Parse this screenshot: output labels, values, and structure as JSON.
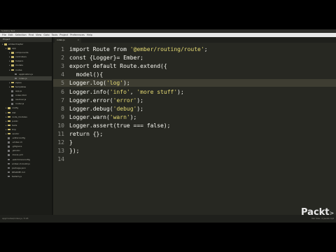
{
  "window": {
    "title": "Sublime Text"
  },
  "menu": [
    "File",
    "Edit",
    "Selection",
    "Find",
    "View",
    "Goto",
    "Tools",
    "Project",
    "Preferences",
    "Help"
  ],
  "sidebar": {
    "header": "Project",
    "items": [
      {
        "label": "emberchapter",
        "depth": 0,
        "type": "folder",
        "color": "#c9b96a"
      },
      {
        "label": "app",
        "depth": 1,
        "type": "folder",
        "color": "#c9b96a"
      },
      {
        "label": "components",
        "depth": 2,
        "type": "folder",
        "color": "#c9b96a"
      },
      {
        "label": "controllers",
        "depth": 2,
        "type": "folder",
        "color": "#c9b96a"
      },
      {
        "label": "helpers",
        "depth": 2,
        "type": "folder",
        "color": "#c9b96a"
      },
      {
        "label": "models",
        "depth": 2,
        "type": "folder",
        "color": "#c9b96a"
      },
      {
        "label": "routes",
        "depth": 2,
        "type": "folder",
        "color": "#c9b96a"
      },
      {
        "label": "application.js",
        "depth": 3,
        "type": "file"
      },
      {
        "label": "index.js",
        "depth": 3,
        "type": "file",
        "selected": true
      },
      {
        "label": "styles",
        "depth": 2,
        "type": "folder",
        "color": "#c9b96a"
      },
      {
        "label": "templates",
        "depth": 2,
        "type": "folder",
        "color": "#c9b96a"
      },
      {
        "label": "app.js",
        "depth": 2,
        "type": "file"
      },
      {
        "label": "index.html",
        "depth": 2,
        "type": "file"
      },
      {
        "label": "resolver.js",
        "depth": 2,
        "type": "file"
      },
      {
        "label": "router.js",
        "depth": 2,
        "type": "file"
      },
      {
        "label": "config",
        "depth": 1,
        "type": "folder",
        "color": "#c9b96a"
      },
      {
        "label": "dist",
        "depth": 1,
        "type": "folder",
        "color": "#c9b96a"
      },
      {
        "label": "node_modules",
        "depth": 1,
        "type": "folder",
        "color": "#c9b96a"
      },
      {
        "label": "public",
        "depth": 1,
        "type": "folder",
        "color": "#c9b96a"
      },
      {
        "label": "tests",
        "depth": 1,
        "type": "folder",
        "color": "#c9b96a"
      },
      {
        "label": "tmp",
        "depth": 1,
        "type": "folder",
        "color": "#c9b96a"
      },
      {
        "label": "vendor",
        "depth": 1,
        "type": "folder",
        "color": "#c9b96a"
      },
      {
        "label": ".editorconfig",
        "depth": 1,
        "type": "file"
      },
      {
        "label": ".ember-cli",
        "depth": 1,
        "type": "file"
      },
      {
        "label": ".gitignore",
        "depth": 1,
        "type": "file"
      },
      {
        "label": ".jshintrc",
        "depth": 1,
        "type": "file"
      },
      {
        "label": ".travis.yml",
        "depth": 1,
        "type": "file"
      },
      {
        "label": ".watchmanconfig",
        "depth": 1,
        "type": "file"
      },
      {
        "label": "ember-cli-build.js",
        "depth": 1,
        "type": "file"
      },
      {
        "label": "package.json",
        "depth": 1,
        "type": "file"
      },
      {
        "label": "README.md",
        "depth": 1,
        "type": "file"
      },
      {
        "label": "testem.js",
        "depth": 1,
        "type": "file"
      }
    ]
  },
  "tab": {
    "label": "index.js",
    "close": "×"
  },
  "editor": {
    "current_line": 5,
    "lines": [
      [
        [
          "import ",
          "#f8f8f2"
        ],
        [
          "Route ",
          "#f8f8f2"
        ],
        [
          "from ",
          "#f8f8f2"
        ],
        [
          "'@ember/routing/route'",
          "#e6db74"
        ],
        [
          ";",
          "#f8f8f2"
        ]
      ],
      [
        [
          "const ",
          "#f8f8f2"
        ],
        [
          "{Logger}",
          "#f8f8f2"
        ],
        [
          "= Ember;",
          "#f8f8f2"
        ]
      ],
      [
        [
          "export ",
          "#f8f8f2"
        ],
        [
          "default ",
          "#f8f8f2"
        ],
        [
          "Route.extend({",
          "#f8f8f2"
        ]
      ],
      [
        [
          "  model(){",
          "#f8f8f2"
        ]
      ],
      [
        [
          "Logger.log(",
          "#f8f8f2"
        ],
        [
          "'log'",
          "#e6db74"
        ],
        [
          ");",
          "#f8f8f2"
        ]
      ],
      [
        [
          "Logger.info(",
          "#f8f8f2"
        ],
        [
          "'info'",
          "#e6db74"
        ],
        [
          ", ",
          "#f8f8f2"
        ],
        [
          "'more stuff'",
          "#e6db74"
        ],
        [
          ");",
          "#f8f8f2"
        ]
      ],
      [
        [
          "Logger.error(",
          "#f8f8f2"
        ],
        [
          "'error'",
          "#e6db74"
        ],
        [
          ");",
          "#f8f8f2"
        ]
      ],
      [
        [
          "Logger.debug(",
          "#f8f8f2"
        ],
        [
          "'debug'",
          "#e6db74"
        ],
        [
          ");",
          "#f8f8f2"
        ]
      ],
      [
        [
          "Logger.warn(",
          "#f8f8f2"
        ],
        [
          "'warn'",
          "#e6db74"
        ],
        [
          ");",
          "#f8f8f2"
        ]
      ],
      [
        [
          "Logger.assert(true === false);",
          "#f8f8f2"
        ]
      ],
      [
        [
          "return {};",
          "#f8f8f2"
        ]
      ],
      [
        [
          "}",
          "#f8f8f2"
        ]
      ],
      [
        [
          "});",
          "#f8f8f2"
        ]
      ],
      []
    ]
  },
  "status": {
    "left": "app/routes/index.js, 5:18",
    "right": "Tab Size: 4   JavaScript"
  },
  "watermark": {
    "brand": "Packt",
    "mark": ">"
  }
}
